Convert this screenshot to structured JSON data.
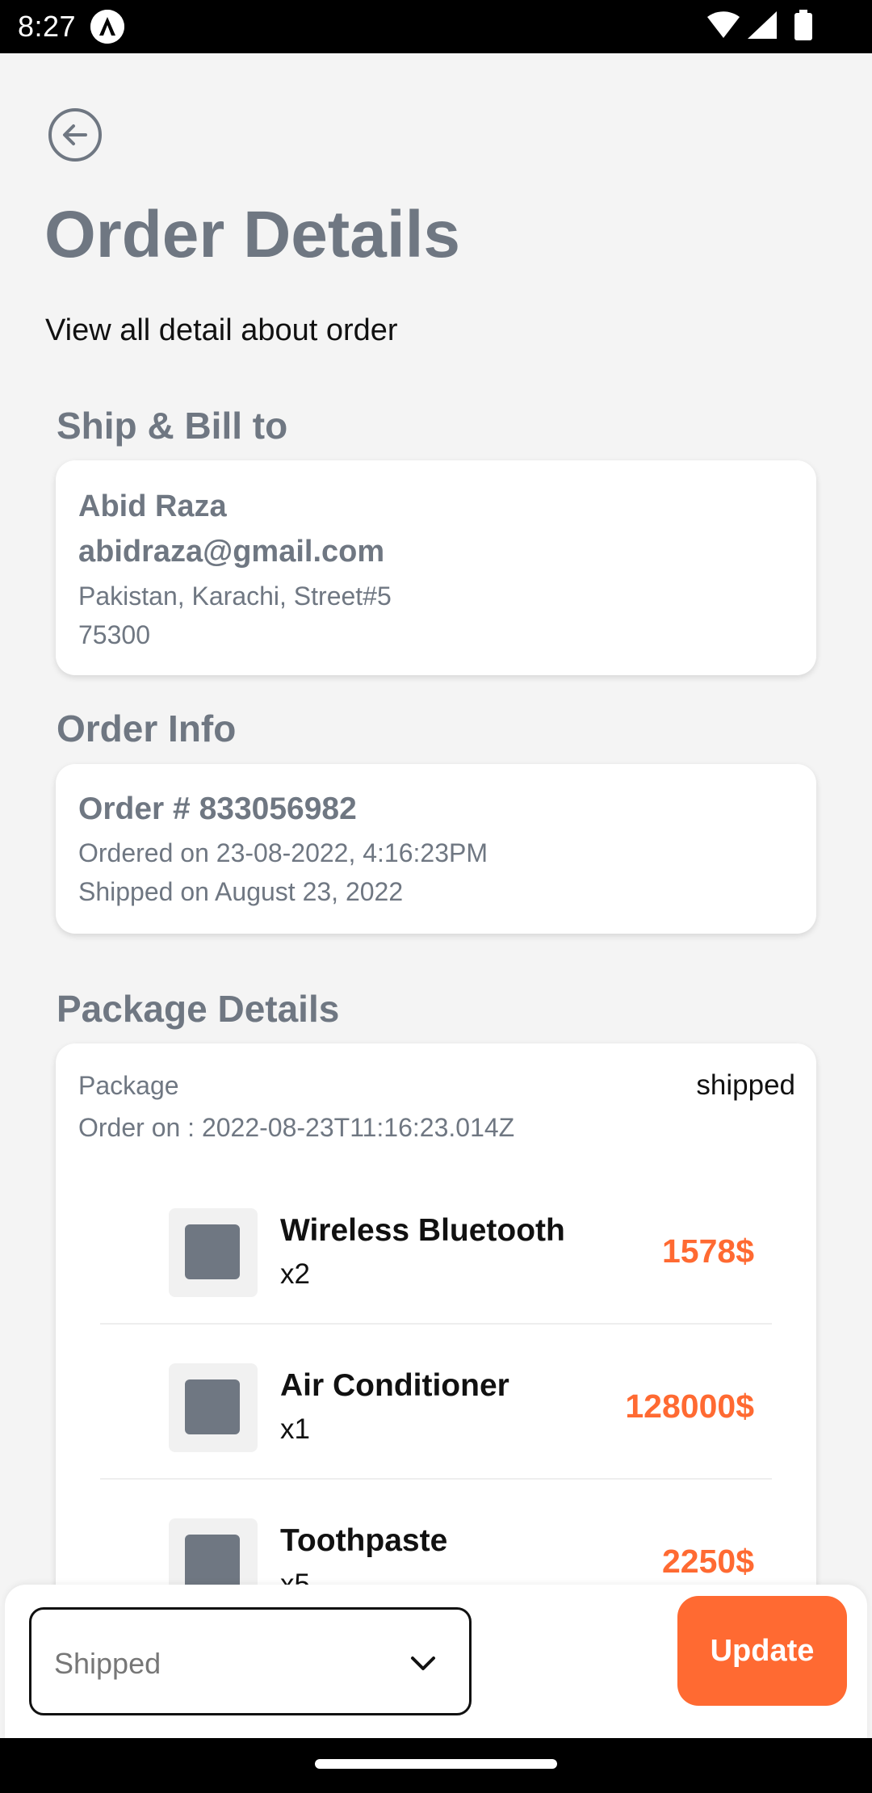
{
  "status_bar": {
    "time": "8:27",
    "icons": [
      "wifi-icon",
      "signal-icon",
      "battery-icon"
    ]
  },
  "header": {
    "back_icon": "arrow-left-circle-icon",
    "title": "Order Details",
    "subtitle": "View all detail about order"
  },
  "ship_bill": {
    "section_title": "Ship & Bill to",
    "name": "Abid Raza",
    "email": "abidraza@gmail.com",
    "address": "Pakistan, Karachi, Street#5",
    "postal_code": "75300"
  },
  "order_info": {
    "section_title": "Order Info",
    "order_number": "Order # 833056982",
    "ordered_on": "Ordered on 23-08-2022, 4:16:23PM",
    "shipped_on": "Shipped on August 23, 2022"
  },
  "package_details": {
    "section_title": "Package Details",
    "package_label": "Package",
    "package_status": "shipped",
    "order_on": "Order on : 2022-08-23T11:16:23.014Z",
    "items": [
      {
        "name": "Wireless Bluetooth",
        "qty": "x2",
        "price": "1578$"
      },
      {
        "name": "Air Conditioner",
        "qty": "x1",
        "price": "128000$"
      },
      {
        "name": "Toothpaste",
        "qty": "x5",
        "price": "2250$"
      }
    ]
  },
  "bottom_bar": {
    "selected_status": "Shipped",
    "update_label": "Update",
    "chevron_icon": "chevron-down-icon"
  },
  "colors": {
    "accent": "#ff6a32",
    "muted_text": "#6f7782",
    "background": "#f4f4f4"
  }
}
